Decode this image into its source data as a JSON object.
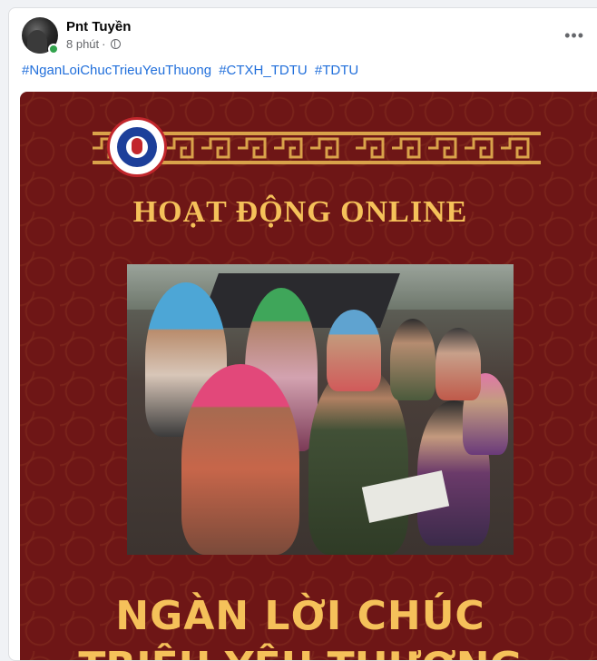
{
  "post": {
    "author": "Pnt Tuyền",
    "time": "8 phút",
    "separator": "·",
    "more_label": "•••",
    "hashtags": [
      "#NganLoiChucTrieuYeuThuong",
      "#CTXH_TDTU",
      "#TDTU"
    ]
  },
  "poster": {
    "background_color": "#6e1616",
    "accent_color": "#f5c15a",
    "heading": "HOẠT ĐỘNG ONLINE",
    "big_title_line1": "NGÀN LỜI CHÚC",
    "big_title_line2": "TRIỆU YÊU THƯƠNG",
    "logo_icon": "social-work-team-logo"
  },
  "colors": {
    "link": "#216fdb",
    "online": "#31a24c"
  }
}
